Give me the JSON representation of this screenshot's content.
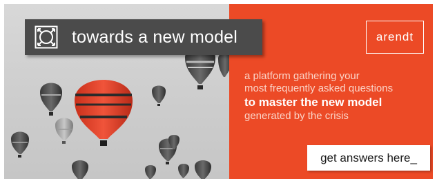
{
  "headline": {
    "text": "towards a new model",
    "icon": "expand-frame-icon"
  },
  "logo": {
    "text": "arendt"
  },
  "description": {
    "line1": "a platform gathering your",
    "line2": "most frequently asked questions",
    "line3": "to master the new model",
    "line4": "generated by the crisis"
  },
  "cta": {
    "label": "get answers here_"
  },
  "colors": {
    "accent": "#ec4a26",
    "headline_bg": "#4b4b4b",
    "balloon_highlight": "#e94a2c"
  }
}
